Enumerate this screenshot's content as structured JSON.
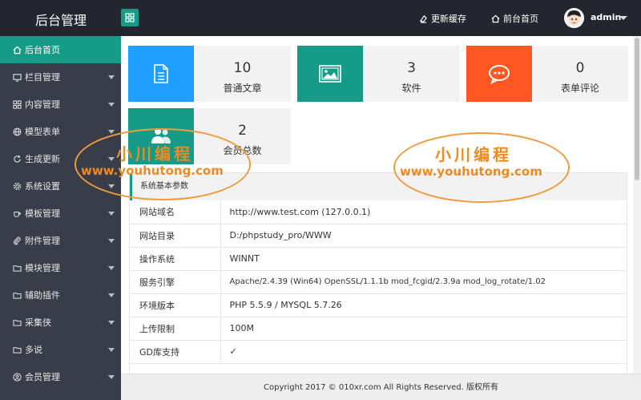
{
  "header": {
    "logo": "后台管理",
    "refresh_cache": "更新缓存",
    "front_home": "前台首页",
    "user": "admin"
  },
  "sidebar": {
    "items": [
      {
        "label": "后台首页",
        "icon": "home-icon"
      },
      {
        "label": "栏目管理",
        "icon": "monitor-icon"
      },
      {
        "label": "内容管理",
        "icon": "grid-icon"
      },
      {
        "label": "模型表单",
        "icon": "globe-icon"
      },
      {
        "label": "生成更新",
        "icon": "refresh-icon"
      },
      {
        "label": "系统设置",
        "icon": "gear-icon"
      },
      {
        "label": "模板管理",
        "icon": "cup-icon"
      },
      {
        "label": "附件管理",
        "icon": "clip-icon"
      },
      {
        "label": "模块管理",
        "icon": "folder-icon"
      },
      {
        "label": "辅助插件",
        "icon": "folder-icon"
      },
      {
        "label": "采集侠",
        "icon": "folder-icon"
      },
      {
        "label": "多说",
        "icon": "folder-icon"
      },
      {
        "label": "会员管理",
        "icon": "user-circle-icon"
      }
    ]
  },
  "stats": [
    {
      "value": "10",
      "label": "普通文章",
      "color": "#1e9fff",
      "icon": "document-icon"
    },
    {
      "value": "3",
      "label": "软件",
      "color": "#159b88",
      "icon": "image-icon"
    },
    {
      "value": "0",
      "label": "表单评论",
      "color": "#ff5722",
      "icon": "chat-icon"
    },
    {
      "value": "2",
      "label": "会员总数",
      "color": "#159b88",
      "icon": "users-icon"
    }
  ],
  "system": {
    "title": "系统基本参数",
    "rows": [
      {
        "key": "网站域名",
        "value": "http://www.test.com (127.0.0.1)"
      },
      {
        "key": "网站目录",
        "value": "D:/phpstudy_pro/WWW"
      },
      {
        "key": "操作系统",
        "value": "WINNT"
      },
      {
        "key": "服务引擎",
        "value": "Apache/2.4.39 (Win64) OpenSSL/1.1.1b mod_fcgid/2.3.9a mod_log_rotate/1.02"
      },
      {
        "key": "环境版本",
        "value": "PHP 5.5.9 / MYSQL 5.7.26"
      },
      {
        "key": "上传限制",
        "value": "100M"
      },
      {
        "key": "GD库支持",
        "value": "✓"
      }
    ]
  },
  "footer": "Copyright 2017 © 010xr.com All Rights Reserved. 版权所有",
  "watermark": {
    "line1": "小川编程",
    "line2": "www.youhutong.com"
  },
  "colors": {
    "header": "#23262e",
    "sidebar": "#393d49",
    "accent": "#159b88"
  }
}
